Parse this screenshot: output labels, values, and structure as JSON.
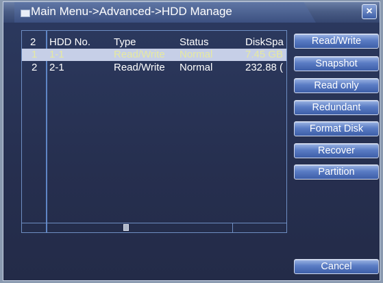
{
  "window": {
    "title": "Main Menu->Advanced->HDD Manage",
    "close_glyph": "×"
  },
  "table": {
    "headers": {
      "index": "2",
      "hdd_no": "HDD No.",
      "type": "Type",
      "status": "Status",
      "disk_space": "DiskSpa"
    },
    "rows": [
      {
        "index": "1",
        "hdd_no": "1-1",
        "type": "Read/Write",
        "status": "Normal",
        "disk_space": "7.45 GB",
        "selected": true
      },
      {
        "index": "2",
        "hdd_no": "2-1",
        "type": "Read/Write",
        "status": "Normal",
        "disk_space": "232.88 (",
        "selected": false
      }
    ]
  },
  "buttons": {
    "read_write": "Read/Write",
    "snapshot": "Snapshot",
    "read_only": "Read only",
    "redundant": "Redundant",
    "format_disk": "Format Disk",
    "recover": "Recover",
    "partition": "Partition",
    "cancel": "Cancel"
  },
  "colors": {
    "background": "#262f4f",
    "selected_row": "#c6cfe7",
    "selected_text": "#e6e9a0",
    "button": "#5a7cc4"
  },
  "icons": {
    "window": "window-icon",
    "close": "close-icon"
  }
}
